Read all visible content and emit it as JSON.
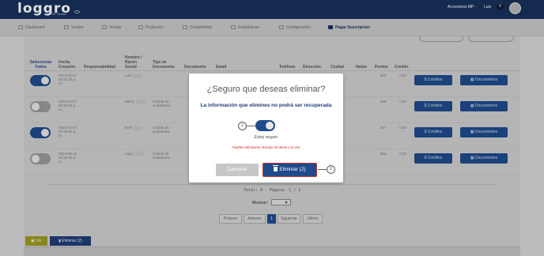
{
  "header": {
    "logo": "loggro",
    "logo_sub": "POS Tienda",
    "account": "Accesorios MP -",
    "user": "Luis",
    "notifications": "0"
  },
  "nav": [
    {
      "label": "Dashboard",
      "icon": "dashboard-icon"
    },
    {
      "label": "Vender",
      "icon": "cart-icon"
    },
    {
      "label": "Ventas",
      "icon": "sales-icon"
    },
    {
      "label": "Productos",
      "icon": "box-icon"
    },
    {
      "label": "Contabilidad",
      "icon": "ledger-icon"
    },
    {
      "label": "Estadísticas",
      "icon": "chart-icon"
    },
    {
      "label": "Configuración",
      "icon": "gear-icon"
    },
    {
      "label": "Pagar Suscripción",
      "icon": "card-icon",
      "active": true
    }
  ],
  "table": {
    "headers": {
      "select": "Seleccionar Todos",
      "date": "Fecha Creación",
      "responsible": "Responsabilidad",
      "name": "Nombre / Razón Social",
      "doc_type": "Tipo de Documento",
      "document": "Documento",
      "email": "Email",
      "phone": "Teléfono",
      "address": "Dirección",
      "city": "Ciudad",
      "notes": "Notas",
      "points": "Puntos",
      "credit": "Crédito"
    },
    "rows": [
      {
        "selected": true,
        "date": "2024-03-07 06:32:24 p. m.",
        "name": "Luis",
        "doc_type": "",
        "points": "350",
        "credit": "0,00"
      },
      {
        "selected": false,
        "date": "2024-03-07 06:29:56 p. m.",
        "name": "María",
        "doc_type": "Cédula de ciudadanía",
        "points": "398",
        "credit": "0,00"
      },
      {
        "selected": true,
        "date": "2024-03-07 07:49:55 p. m.",
        "name": "Raff",
        "doc_type": "Cédula de ciudadanía",
        "points": "457",
        "credit": "0,00"
      },
      {
        "selected": false,
        "date": "2024-03-12 10:10:29 p. m.",
        "name": "mary",
        "doc_type": "Cédula de ciudadanía",
        "points": "256",
        "credit": "0,00"
      }
    ],
    "btn_credits": "$ Créditos",
    "btn_docs": "Documentos"
  },
  "footer": {
    "total": "Total: 4 - Página: 1 / 1",
    "show_label": "Mostrar:",
    "pager": [
      "Primero",
      "Anterior",
      "1",
      "Siguiente",
      "Último"
    ],
    "btn_view": "Ver",
    "btn_delete_bulk": "Eliminar (2)"
  },
  "modal": {
    "title": "¿Seguro que deseas eliminar?",
    "subtitle": "La información que elimines no podrá ser recuperada",
    "confirm_label": "Estoy seguro",
    "limit_note": "Pueden eliminarse máximo 50 items a la vez",
    "cancel": "Cancelar",
    "confirm": "Eliminar (2)",
    "step_1": "1",
    "step_2": "2"
  }
}
